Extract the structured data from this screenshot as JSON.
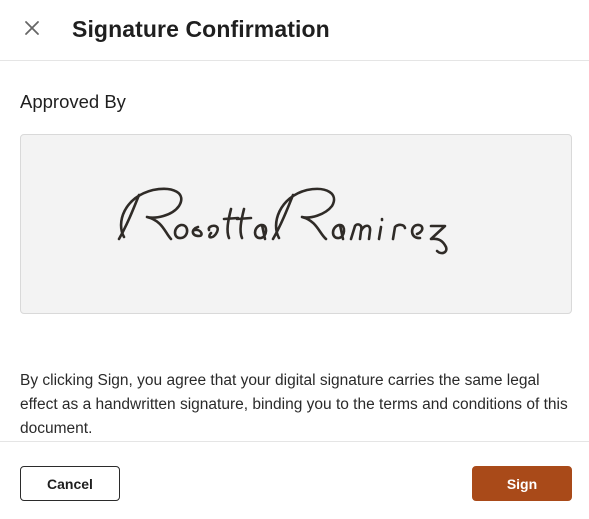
{
  "dialog": {
    "title": "Signature Confirmation",
    "close_icon": "close-icon"
  },
  "approval": {
    "label": "Approved By",
    "signer_name": "Rosetta Ramirez"
  },
  "disclaimer": "By clicking Sign, you agree that your digital signature carries the same legal effect as a handwritten signature, binding you to the terms and conditions of this document.",
  "actions": {
    "cancel_label": "Cancel",
    "sign_label": "Sign"
  },
  "colors": {
    "accent": "#a94a19",
    "signature_box_bg": "#f3f3f3",
    "signature_ink": "#2f2b27"
  }
}
